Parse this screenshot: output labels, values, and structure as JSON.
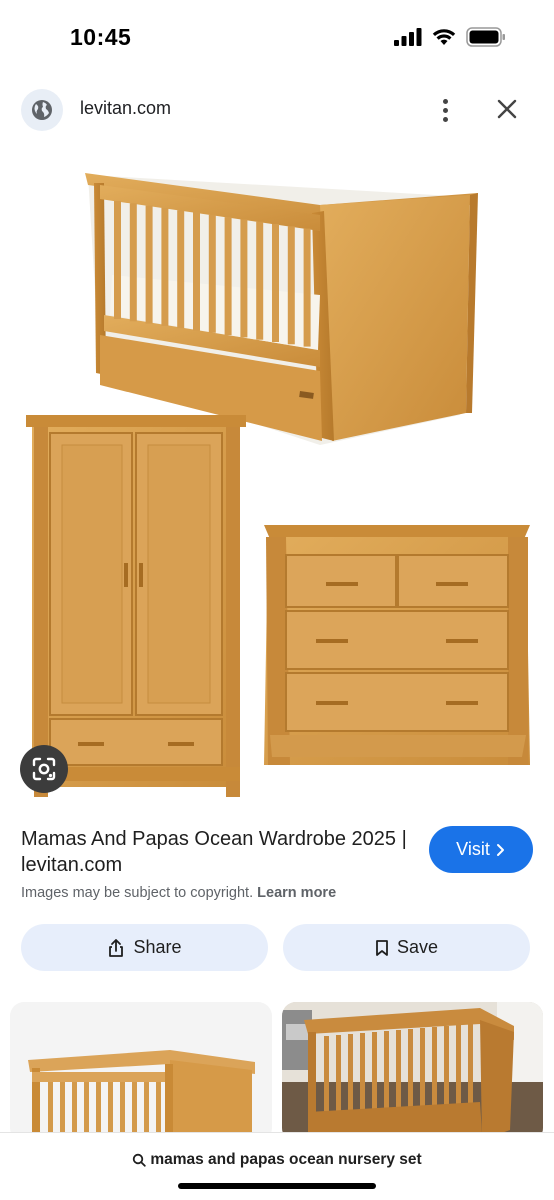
{
  "status_bar": {
    "time": "10:45"
  },
  "header": {
    "site": "levitan.com",
    "icons": [
      "globe-icon",
      "more-vert-icon",
      "close-icon"
    ]
  },
  "result": {
    "title": "Mamas And Papas Ocean Wardrobe 2025 | levitan.com",
    "visit_label": "Visit",
    "copyright_text": "Images may be subject to copyright.",
    "learn_more": "Learn more"
  },
  "actions": {
    "share_label": "Share",
    "save_label": "Save"
  },
  "search": {
    "query": "mamas and papas ocean nursery set"
  },
  "colors": {
    "accent": "#1a73e8",
    "chip_bg": "#e7eefb",
    "wood": "#d9a14e"
  }
}
